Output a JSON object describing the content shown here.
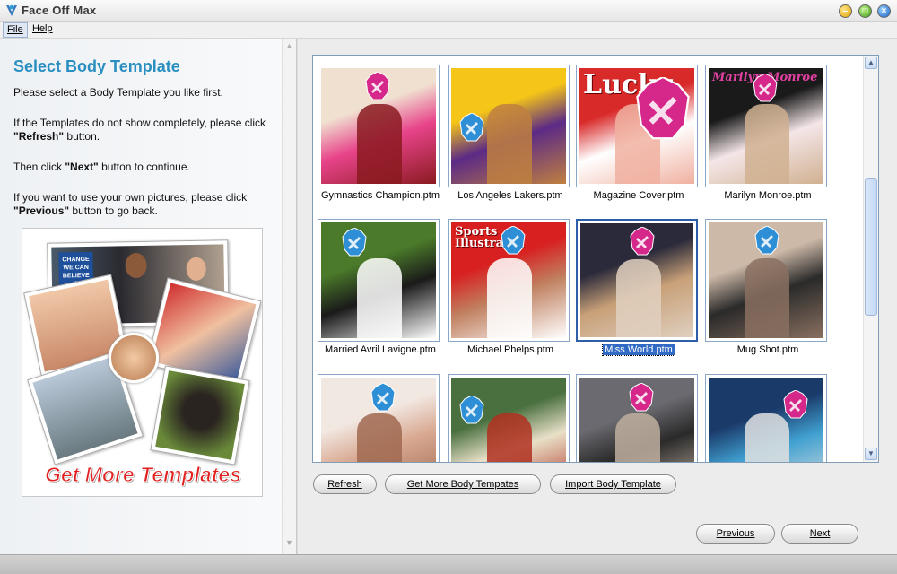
{
  "window": {
    "title": "Face Off Max"
  },
  "menu": {
    "file": "File",
    "help": "Help"
  },
  "left": {
    "heading": "Select Body Template",
    "p1": "Please select a Body Template you like first.",
    "p2_a": "If the Templates do not show completely, please click ",
    "p2_b": "\"Refresh\"",
    "p2_c": " button.",
    "p3_a": "Then click ",
    "p3_b": "\"Next\"",
    "p3_c": " button to continue.",
    "p4_a": "If you want to use your own pictures, please click ",
    "p4_b": "\"Previous\"",
    "p4_c": " button to go back.",
    "promo": "Get More Templates",
    "promo_sign": "CHANGE WE CAN BELIEVE IN"
  },
  "templates": [
    {
      "caption": "Gymnastics Champion.ptm",
      "selected": false,
      "colors": [
        "#f0e0d0",
        "#e8448a",
        "#8a1a20"
      ]
    },
    {
      "caption": "Los Angeles Lakers.ptm",
      "selected": false,
      "colors": [
        "#f5c518",
        "#5c2a86",
        "#c08040"
      ]
    },
    {
      "caption": "Magazine Cover.ptm",
      "selected": false,
      "colors": [
        "#d92a2a",
        "#ffffff",
        "#f0b0a0"
      ],
      "text": "Lucky"
    },
    {
      "caption": "Marilyn Monroe.ptm",
      "selected": false,
      "colors": [
        "#1a1a1a",
        "#f4e6e8",
        "#d0b090"
      ],
      "text": "Marilyn Monroe"
    },
    {
      "caption": "Married Avril Lavigne.ptm",
      "selected": false,
      "colors": [
        "#4a7a2a",
        "#1a1a1a",
        "#ffffff"
      ]
    },
    {
      "caption": "Michael Phelps.ptm",
      "selected": false,
      "colors": [
        "#d82020",
        "#c08060",
        "#ffffff"
      ],
      "text": "Sports Illustrated"
    },
    {
      "caption": "Miss World.ptm",
      "selected": true,
      "colors": [
        "#2a2a3a",
        "#c8a078",
        "#e0d0c0"
      ]
    },
    {
      "caption": "Mug Shot.ptm",
      "selected": false,
      "colors": [
        "#cdb9a8",
        "#2a2a2a",
        "#8a7060"
      ]
    },
    {
      "caption": "",
      "selected": false,
      "colors": [
        "#f2e8e2",
        "#d8a890",
        "#a06850"
      ]
    },
    {
      "caption": "",
      "selected": false,
      "colors": [
        "#4a7040",
        "#e8e0c8",
        "#b03020"
      ]
    },
    {
      "caption": "",
      "selected": false,
      "colors": [
        "#6a6a70",
        "#2a2a2a",
        "#c0b0a0"
      ]
    },
    {
      "caption": "",
      "selected": false,
      "colors": [
        "#1a3a6a",
        "#40a0d0",
        "#e0e0e0"
      ]
    }
  ],
  "buttons": {
    "refresh": "Refresh",
    "get_more": "Get More Body Tempates",
    "import": "Import Body Template",
    "previous": "Previous",
    "next": "Next"
  },
  "icons": {
    "app": "app-logo-icon",
    "minimize": "minimize-icon",
    "maximize": "maximize-icon",
    "close": "close-icon",
    "face": "face-placeholder-icon",
    "scroll_up": "scroll-up-icon",
    "scroll_down": "scroll-down-icon"
  }
}
